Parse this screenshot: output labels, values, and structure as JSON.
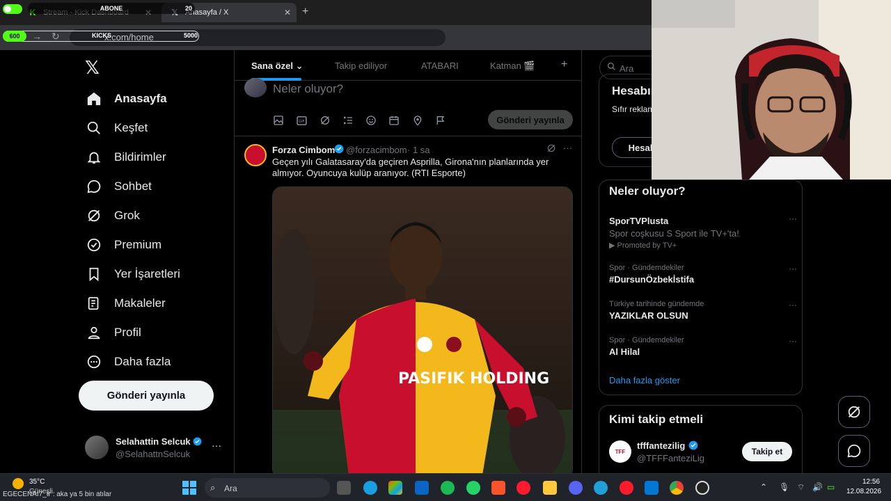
{
  "browser": {
    "tabs": [
      {
        "title": "Stream - Kick Dashboard",
        "icon": "kick-icon",
        "close": "✕"
      },
      {
        "title": "Anasayfa / X",
        "icon": "x-icon",
        "close": "✕"
      }
    ],
    "new_tab": "+",
    "url": "x.com/home"
  },
  "overlay": {
    "top_label": "ABONE",
    "top_count": "20",
    "kicks_label": "KICKS",
    "kicks_current": "600",
    "kicks_goal": "5000"
  },
  "nav": {
    "logo": "𝕏",
    "items": [
      {
        "label": "Anasayfa",
        "icon": "home-icon"
      },
      {
        "label": "Keşfet",
        "icon": "search-icon"
      },
      {
        "label": "Bildirimler",
        "icon": "bell-icon"
      },
      {
        "label": "Sohbet",
        "icon": "chat-icon"
      },
      {
        "label": "Grok",
        "icon": "grok-icon"
      },
      {
        "label": "Premium",
        "icon": "verified-icon"
      },
      {
        "label": "Yer İşaretleri",
        "icon": "bookmark-icon"
      },
      {
        "label": "Makaleler",
        "icon": "article-icon"
      },
      {
        "label": "Profil",
        "icon": "person-icon"
      },
      {
        "label": "Daha fazla",
        "icon": "more-circle-icon"
      }
    ],
    "post_button": "Gönderi yayınla",
    "account": {
      "name": "Selahattin Selcuk",
      "handle": "@SelahattnSelcuk",
      "more": "···"
    }
  },
  "feed": {
    "tabs": [
      {
        "label": "Sana özel ⌄"
      },
      {
        "label": "Takip ediliyor"
      },
      {
        "label": "ATABARI"
      },
      {
        "label": "Katman 🎬"
      }
    ],
    "add_tab": "+",
    "composer": {
      "placeholder": "Neler oluyor?",
      "post_button": "Gönderi yayınla"
    },
    "tweet": {
      "name": "Forza Cimbom",
      "handle": "@forzacimbom",
      "time": "· 1 sa",
      "text": "Geçen yılı Galatasaray'da geçiren Asprilla, Girona'nın planlarında yer almıyor. Oyuncuya kulüp aranıyor. (RTI Esporte)",
      "media": {
        "shirt_text": "PASIFIK HOLDING"
      }
    }
  },
  "sidebar": {
    "search_placeholder": "Ara",
    "premium": {
      "title": "Hesabın",
      "text": "Sıfır reklam avantajları",
      "button": "Hesabı"
    },
    "trends_title": "Neler oluyor?",
    "trends": [
      {
        "name": "SporTVPlusta",
        "desc": "Spor coşkusu S Sport ile TV+'ta!",
        "promo": "Promoted by TV+"
      },
      {
        "meta": "Spor · Gündemdekiler",
        "name": "#DursunÖzbekİstifa"
      },
      {
        "meta": "Türkiye tarihinde gündemde",
        "name": "YAZIKLAR OLSUN"
      },
      {
        "meta": "Spor · Gündemdekiler",
        "name": "Al Hilal"
      }
    ],
    "show_more": "Daha fazla göster",
    "who_to_follow": {
      "title": "Kimi takip etmeli",
      "name": "tfffantezilig",
      "handle": "@TFFFanteziLig",
      "button": "Takip et",
      "avatar_text": "TFF"
    }
  },
  "taskbar": {
    "temp": "35°C",
    "weather": "Güneşli",
    "ticker": "EGECENAI7_tr : aka ya 5 bin atılar",
    "search_placeholder": "Ara",
    "time": "12:56",
    "date": "12.08.2026"
  },
  "colors": {
    "accent": "#1d9bf0",
    "kick_green": "#53fc18",
    "galatasaray_red": "#c8102e",
    "galatasaray_yellow": "#f3b81c"
  }
}
